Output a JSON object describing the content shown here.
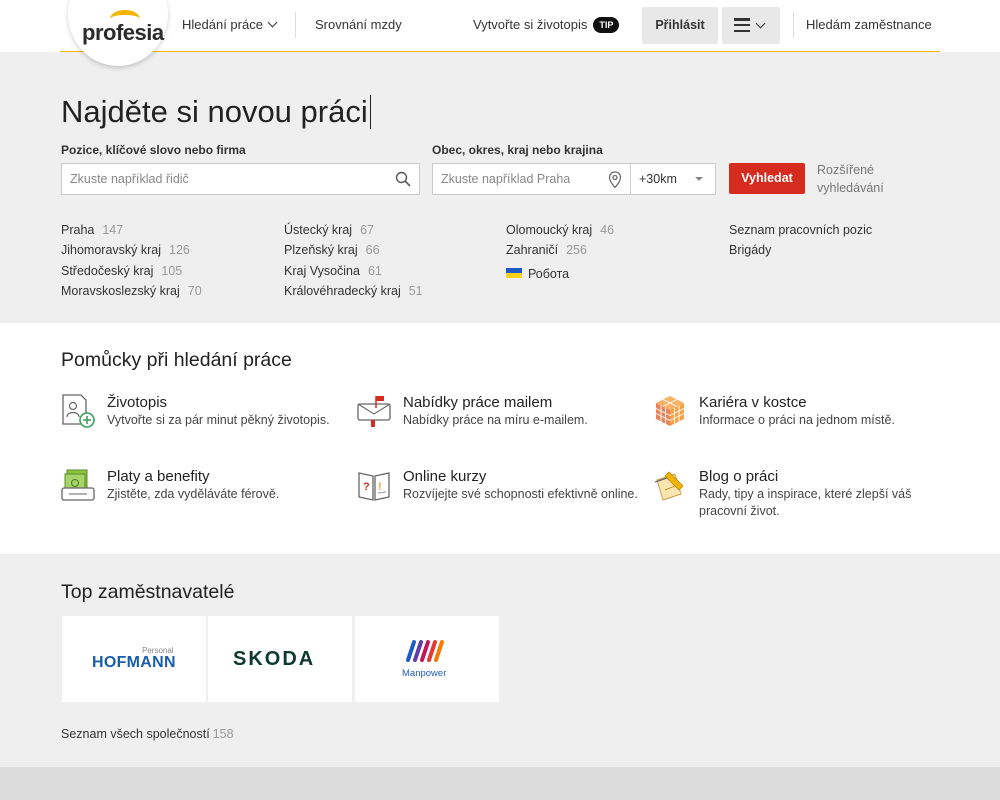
{
  "header": {
    "logo_text": "profesia",
    "nav": {
      "job_search": "Hledání práce",
      "salary_compare": "Srovnání mzdy",
      "create_cv": "Vytvořte si životopis",
      "tip_badge": "TIP",
      "login": "Přihlásit",
      "employers": "Hledám zaměstnance"
    },
    "accent_color": "#f4b400"
  },
  "hero": {
    "title": "Najděte si novou práci",
    "position_label": "Pozice, klíčové slovo nebo firma",
    "position_placeholder": "Zkuste například řidič",
    "location_label": "Obec, okres, kraj nebo krajina",
    "location_placeholder": "Zkuste například Praha",
    "radius_value": "+30km",
    "search_button": "Vyhledat",
    "search_button_color": "#d62b1f",
    "advanced_search": "Rozšířené vyhledávání",
    "regions": [
      [
        {
          "name": "Praha",
          "count": "147"
        },
        {
          "name": "Jihomoravský kraj",
          "count": "126"
        },
        {
          "name": "Středočeský kraj",
          "count": "105"
        },
        {
          "name": "Moravskoslezský kraj",
          "count": "70"
        }
      ],
      [
        {
          "name": "Ústecký kraj",
          "count": "67"
        },
        {
          "name": "Plzeňský kraj",
          "count": "66"
        },
        {
          "name": "Kraj Vysočina",
          "count": "61"
        },
        {
          "name": "Královéhradecký kraj",
          "count": "51"
        }
      ],
      [
        {
          "name": "Olomoucký kraj",
          "count": "46"
        },
        {
          "name": "Zahraničí",
          "count": "256"
        },
        {
          "name": "Робота",
          "count": ""
        }
      ],
      [
        {
          "name": "Seznam pracovních pozic",
          "count": ""
        },
        {
          "name": "Brigády",
          "count": ""
        }
      ]
    ]
  },
  "tools": {
    "title": "Pomůcky při hledání práce",
    "items": [
      {
        "title": "Životopis",
        "desc": "Vytvořte si za pár minut pěkný životopis.",
        "icon": "cv-icon"
      },
      {
        "title": "Nabídky práce mailem",
        "desc": "Nabídky práce na míru e-mailem.",
        "icon": "mailbox-icon"
      },
      {
        "title": "Kariéra v kostce",
        "desc": "Informace o práci na jednom místě.",
        "icon": "cube-icon"
      },
      {
        "title": "Platy a benefity",
        "desc": "Zjistěte, zda vyděláváte férově.",
        "icon": "salary-icon"
      },
      {
        "title": "Online kurzy",
        "desc": "Rozvíjejte své schopnosti efektivně online.",
        "icon": "book-icon"
      },
      {
        "title": "Blog o práci",
        "desc": "Rady, tipy a inspirace, které zlepší váš pracovní život.",
        "icon": "blog-icon"
      }
    ]
  },
  "employers": {
    "title": "Top zaměstnavatelé",
    "logos": [
      {
        "name": "HOFMANN",
        "sub": "Personal"
      },
      {
        "name": "SKODA",
        "sub": ""
      },
      {
        "name": "Manpower",
        "sub": ""
      }
    ],
    "all_link": "Seznam všech společností",
    "all_count": "158"
  }
}
